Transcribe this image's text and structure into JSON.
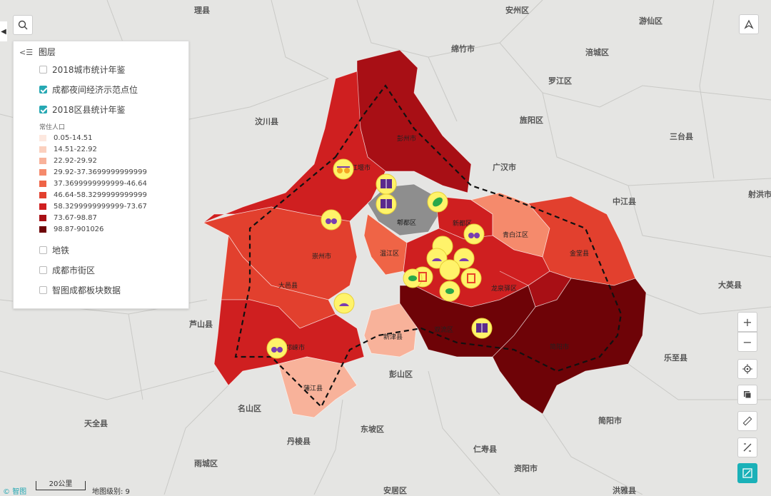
{
  "map": {
    "place_labels": [
      "理县",
      "安州区",
      "游仙区",
      "绵竹市",
      "涪城区",
      "罗江区",
      "汶川县",
      "旌阳区",
      "三台县",
      "广汉市",
      "中江县",
      "射洪市",
      "芦山县",
      "大英县",
      "乐至县",
      "名山区",
      "彭山区",
      "天全县",
      "东坡区",
      "丹棱县",
      "仁寿县",
      "雨城区",
      "安居区",
      "洪雅县",
      "资阳市",
      "简阳市"
    ],
    "district_labels": [
      "彭州市",
      "都江堰市",
      "郫都区",
      "新都区",
      "青白江区",
      "崇州市",
      "温江区",
      "金堂县",
      "大邑县",
      "龙泉驿区",
      "双流区",
      "新津县",
      "简阳市",
      "邛崃市",
      "蒲江县"
    ],
    "fill_colors": {
      "c0": "#fde8df",
      "c1": "#fbd0be",
      "c2": "#f8b29a",
      "c3": "#f58a6c",
      "c4": "#ef6446",
      "c5": "#e2402e",
      "c6": "#cf1f20",
      "c7": "#a80f15",
      "c8": "#6e0307",
      "gray": "#8e8e8e"
    },
    "poi_icons": [
      "sunglasses-icon",
      "book-icon",
      "book-icon",
      "rugby-ball-icon",
      "binoculars-icon",
      "binoculars-icon",
      "shopping-bag-icon",
      "leaf-icon",
      "fan-icon",
      "book-icon",
      "binoculars-icon"
    ]
  },
  "layer_panel": {
    "title": "图层",
    "layers": [
      {
        "label": "2018城市统计年鉴",
        "checked": false
      },
      {
        "label": "成都夜间经济示范点位",
        "checked": true
      },
      {
        "label": "2018区县统计年鉴",
        "checked": true
      }
    ],
    "legend_title": "常住人口",
    "legend": [
      {
        "range": "0.05-14.51",
        "color": "#fde8df"
      },
      {
        "range": "14.51-22.92",
        "color": "#fbd0be"
      },
      {
        "range": "22.92-29.92",
        "color": "#f8b29a"
      },
      {
        "range": "29.92-37.3699999999999",
        "color": "#f58a6c"
      },
      {
        "range": "37.3699999999999-46.64",
        "color": "#ef6446"
      },
      {
        "range": "46.64-58.3299999999999",
        "color": "#e2402e"
      },
      {
        "range": "58.3299999999999-73.67",
        "color": "#cf1f20"
      },
      {
        "range": "73.67-98.87",
        "color": "#a80f15"
      },
      {
        "range": "98.87-901026",
        "color": "#6e0307"
      }
    ],
    "other_layers": [
      {
        "label": "地铁",
        "checked": false
      },
      {
        "label": "成都市街区",
        "checked": false
      },
      {
        "label": "智图成都板块数据",
        "checked": false
      }
    ]
  },
  "controls": {
    "zoom_in": "+",
    "zoom_out": "−"
  },
  "footer": {
    "brand": "智图",
    "scale": "20公里",
    "zoom_level": "地图级别: 9"
  }
}
